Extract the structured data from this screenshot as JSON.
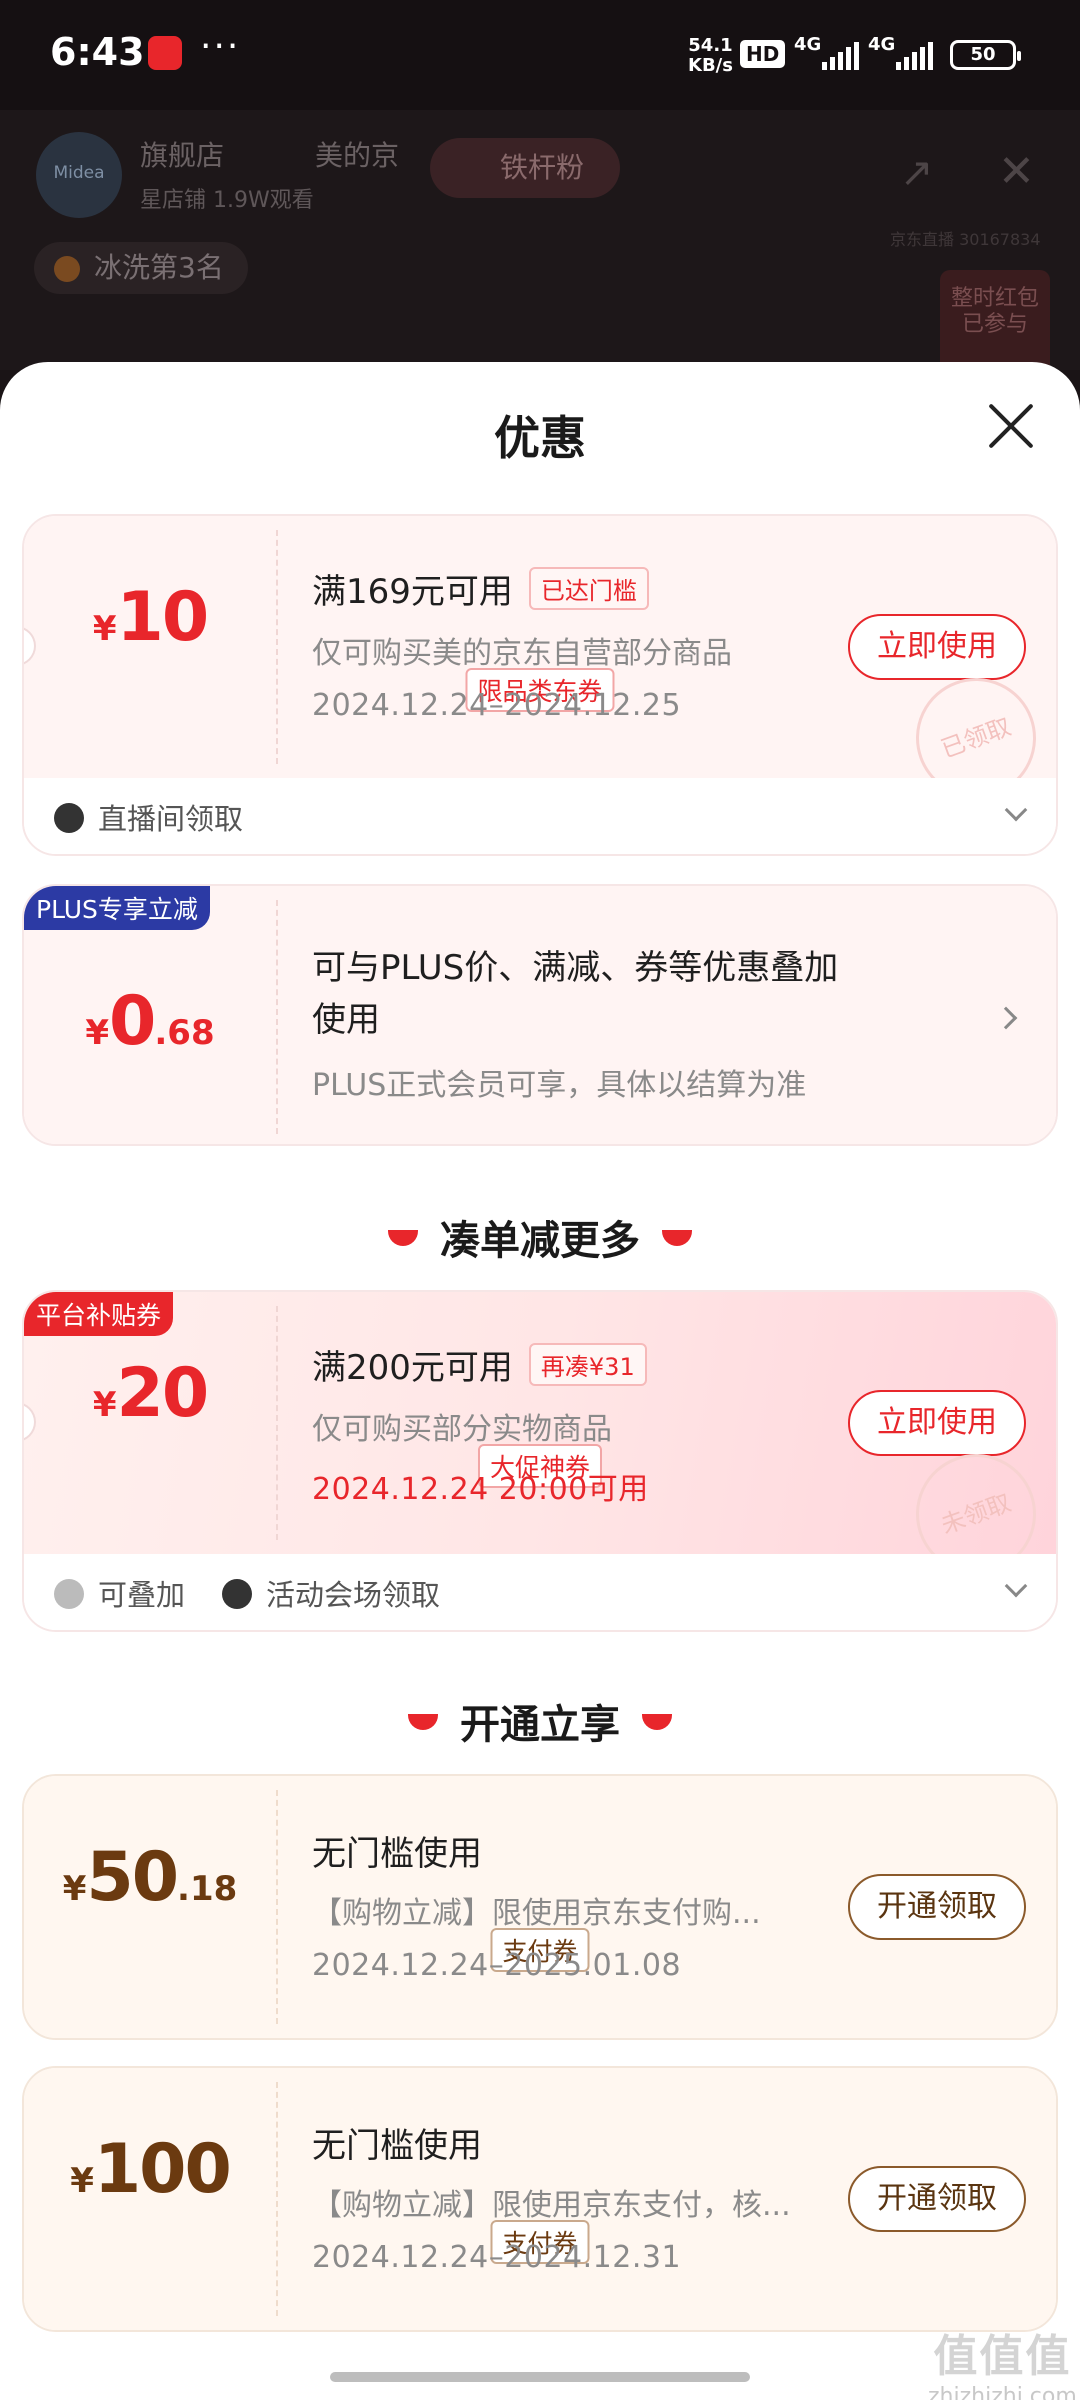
{
  "status_bar": {
    "time": "6:43",
    "more": "···",
    "net_speed_value": "54.1",
    "net_speed_unit": "KB/s",
    "hd": "HD",
    "signal_1": "4G",
    "signal_2": "4G",
    "battery": "50"
  },
  "live_room": {
    "store_logo": "Midea",
    "store_name": "旗舰店",
    "store_type": "星店铺",
    "viewers": "1.9W观看",
    "store_name_2": "美的京",
    "fans_button": "铁杆粉",
    "rank_badge": "冰洗第3名",
    "room_code": "京东直播 30167834",
    "red_packet": "整时红包",
    "red_packet_status": "已参与"
  },
  "sheet": {
    "title": "优惠"
  },
  "coupon1": {
    "currency": "¥",
    "amount": "10",
    "type": "限品类东券",
    "condition": "满169元可用",
    "tag": "已达门槛",
    "desc": "仅可购买美的京东自营部分商品",
    "date": "2024.12.24–2024.12.25",
    "button": "立即使用",
    "stamp": "已领取",
    "source": "直播间领取"
  },
  "plus": {
    "badge": "PLUS专享立减",
    "currency": "¥",
    "amount_int": "0",
    "amount_dec": ".68",
    "title": "可与PLUS价、满减、券等优惠叠加使用",
    "sub": "PLUS正式会员可享，具体以结算为准"
  },
  "section_more": "凑单减更多",
  "coupon2": {
    "badge": "平台补贴券",
    "currency": "¥",
    "amount": "20",
    "type": "大促神券",
    "condition": "满200元可用",
    "tag": "再凑¥31",
    "desc": "仅可购买部分实物商品",
    "date": "2024.12.24 20:00可用",
    "button": "立即使用",
    "stamp": "未领取",
    "stackable": "可叠加",
    "source": "活动会场领取"
  },
  "section_open": "开通立享",
  "pay1": {
    "currency": "¥",
    "amount_int": "50",
    "amount_dec": ".18",
    "type": "支付券",
    "condition": "无门槛使用",
    "desc": "【购物立减】限使用京东支付购...",
    "date": "2024.12.24–2025.01.08",
    "button": "开通领取"
  },
  "pay2": {
    "currency": "¥",
    "amount": "100",
    "type": "支付券",
    "condition": "无门槛使用",
    "desc": "【购物立减】限使用京东支付，核...",
    "date": "2024.12.24–2024.12.31",
    "button": "开通领取"
  },
  "watermark": {
    "logo": "值值值",
    "site": "zhizhizhi.com"
  },
  "colors": {
    "accent_red": "#e8262b",
    "plus_blue": "#2c3aa4",
    "pay_brown": "#6b3a10"
  }
}
